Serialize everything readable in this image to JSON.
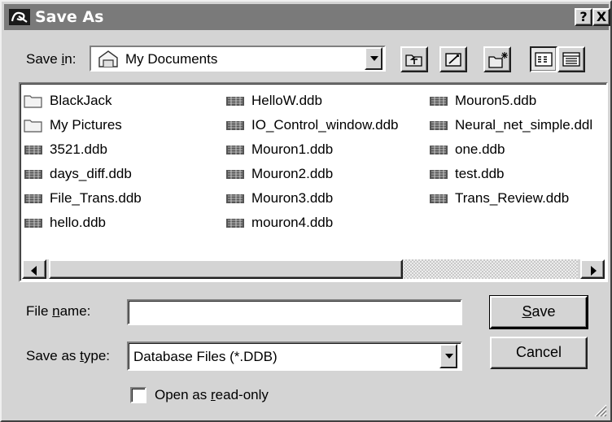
{
  "window": {
    "title": "Save As"
  },
  "titlebar_buttons": {
    "help": "?",
    "close": "X"
  },
  "save_in": {
    "label_prefix": "Save ",
    "label_accel": "i",
    "label_suffix": "n:",
    "value": "My Documents"
  },
  "toolbar": {
    "icons": [
      "up-one-level-icon",
      "desktop-icon",
      "new-folder-icon",
      "list-view-icon",
      "details-view-icon"
    ]
  },
  "files": {
    "col1": [
      "BlackJack",
      "My Pictures",
      "3521.ddb",
      "days_diff.ddb",
      "File_Trans.ddb",
      "hello.ddb"
    ],
    "col2": [
      "HelloW.ddb",
      "IO_Control_window.ddb",
      "Mouron1.ddb",
      "Mouron2.ddb",
      "Mouron3.ddb",
      "mouron4.ddb"
    ],
    "col3": [
      "Mouron5.ddb",
      "Neural_net_simple.ddl",
      "one.ddb",
      "test.ddb",
      "Trans_Review.ddb"
    ]
  },
  "file_name": {
    "label_prefix": "File ",
    "label_accel": "n",
    "label_suffix": "ame:",
    "value": ""
  },
  "save_as_type": {
    "label_prefix": "Save as ",
    "label_accel": "t",
    "label_suffix": "ype:",
    "value": "Database Files (*.DDB)"
  },
  "buttons": {
    "save_accel": "S",
    "save_rest": "ave",
    "cancel": "Cancel"
  },
  "readonly": {
    "label_prefix": "Open as ",
    "label_accel": "r",
    "label_suffix": "ead-only",
    "checked": false
  },
  "colors": {
    "face": "#d4d4d4",
    "titlebar": "#7a7a7a",
    "window_bg": "#ffffff"
  }
}
